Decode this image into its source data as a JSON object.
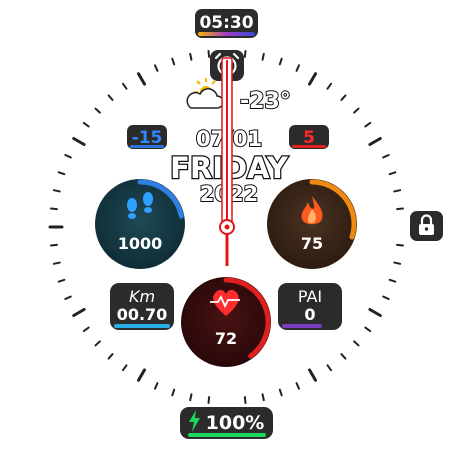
{
  "top_time": "05:30",
  "weather": {
    "icon": "cloud-sun-icon",
    "temperature": "-23°"
  },
  "date": {
    "day_of_month": "07/01",
    "weekday": "FRIDAY",
    "year": "2022"
  },
  "left_badge": "-15",
  "right_badge": "5",
  "steps": {
    "icon": "footprints-icon",
    "value": "1000",
    "progress": 0.22,
    "color": "#2f7fe0"
  },
  "calories": {
    "icon": "flame-icon",
    "value": "75",
    "progress": 0.3,
    "color": "#f08a0e"
  },
  "heart": {
    "icon": "heart-pulse-icon",
    "value": "72",
    "progress": 0.4,
    "color": "#e02020"
  },
  "distance": {
    "unit": "Km",
    "value": "00.70",
    "color": "#2aaee8"
  },
  "pai": {
    "label": "PAI",
    "value": "0",
    "color": "#7a3cc0"
  },
  "battery": {
    "icon": "bolt-icon",
    "value": "100%",
    "color": "#1bd760"
  },
  "lock": {
    "icon": "lock-icon"
  },
  "alarm": {
    "icon": "alarm-clock-icon"
  },
  "colors": {
    "pill_bg": "#2b2b2b",
    "hand": "#e3141a",
    "tick": "#222222"
  }
}
